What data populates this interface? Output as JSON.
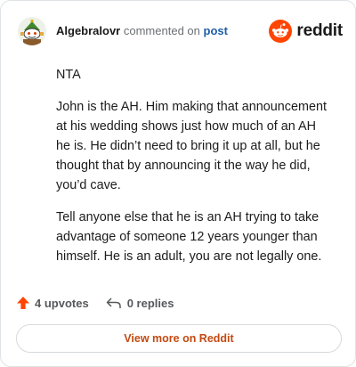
{
  "header": {
    "username": "Algebralovr",
    "commented_text": "commented on",
    "post_link_label": "post",
    "brand": "reddit",
    "avatar_icon": "snoo-avatar-icon",
    "logo_icon": "reddit-snoo-icon"
  },
  "comment": {
    "paragraphs": [
      "NTA",
      "John is the AH. Him making that announcement at his wedding shows just how much of an AH he is. He didn’t need to bring it up at all, but he thought that by announcing it the way he did, you’d cave.",
      "Tell anyone else that he is an AH trying to take advantage of someone 12 years younger than himself. He is an adult, you are not legally one."
    ]
  },
  "actions": {
    "upvotes_label": "4 upvotes",
    "replies_label": "0 replies",
    "upvote_icon": "upvote-arrow-icon",
    "reply_icon": "reply-arrow-icon"
  },
  "footer": {
    "view_more_label": "View more on Reddit"
  },
  "colors": {
    "brand_orange": "#ff4500",
    "link_blue": "#1e5fa8",
    "cta_text": "#c24a12"
  }
}
